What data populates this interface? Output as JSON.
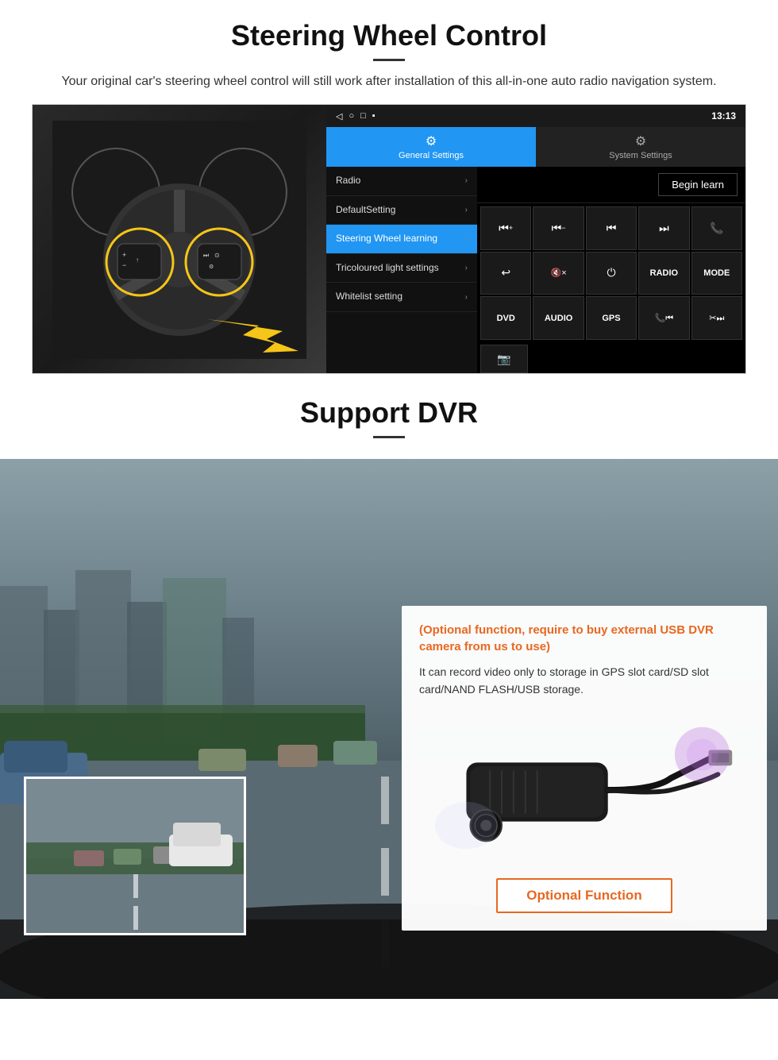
{
  "steering": {
    "title": "Steering Wheel Control",
    "subtitle": "Your original car's steering wheel control will still work after installation of this all-in-one auto radio navigation system.",
    "statusbar": {
      "time": "13:13",
      "nav_icons": [
        "◁",
        "○",
        "□",
        "▪"
      ]
    },
    "tabs": {
      "general": {
        "label": "General Settings",
        "icon": "⚙"
      },
      "system": {
        "label": "System Settings",
        "icon": "🔧"
      }
    },
    "menu": [
      {
        "label": "Radio",
        "active": false
      },
      {
        "label": "DefaultSetting",
        "active": false
      },
      {
        "label": "Steering Wheel learning",
        "active": true
      },
      {
        "label": "Tricoloured light settings",
        "active": false
      },
      {
        "label": "Whitelist setting",
        "active": false
      }
    ],
    "begin_learn_label": "Begin learn",
    "controls": [
      "⏮+",
      "⏮−",
      "⏮⏮",
      "⏭⏭",
      "📞",
      "↩",
      "🔇×",
      "⏻",
      "RADIO",
      "MODE",
      "DVD",
      "AUDIO",
      "GPS",
      "📞⏮",
      "✂⏭"
    ]
  },
  "dvr": {
    "title": "Support DVR",
    "optional_notice": "(Optional function, require to buy external USB DVR camera from us to use)",
    "description": "It can record video only to storage in GPS slot card/SD slot card/NAND FLASH/USB storage.",
    "optional_btn_label": "Optional Function"
  }
}
